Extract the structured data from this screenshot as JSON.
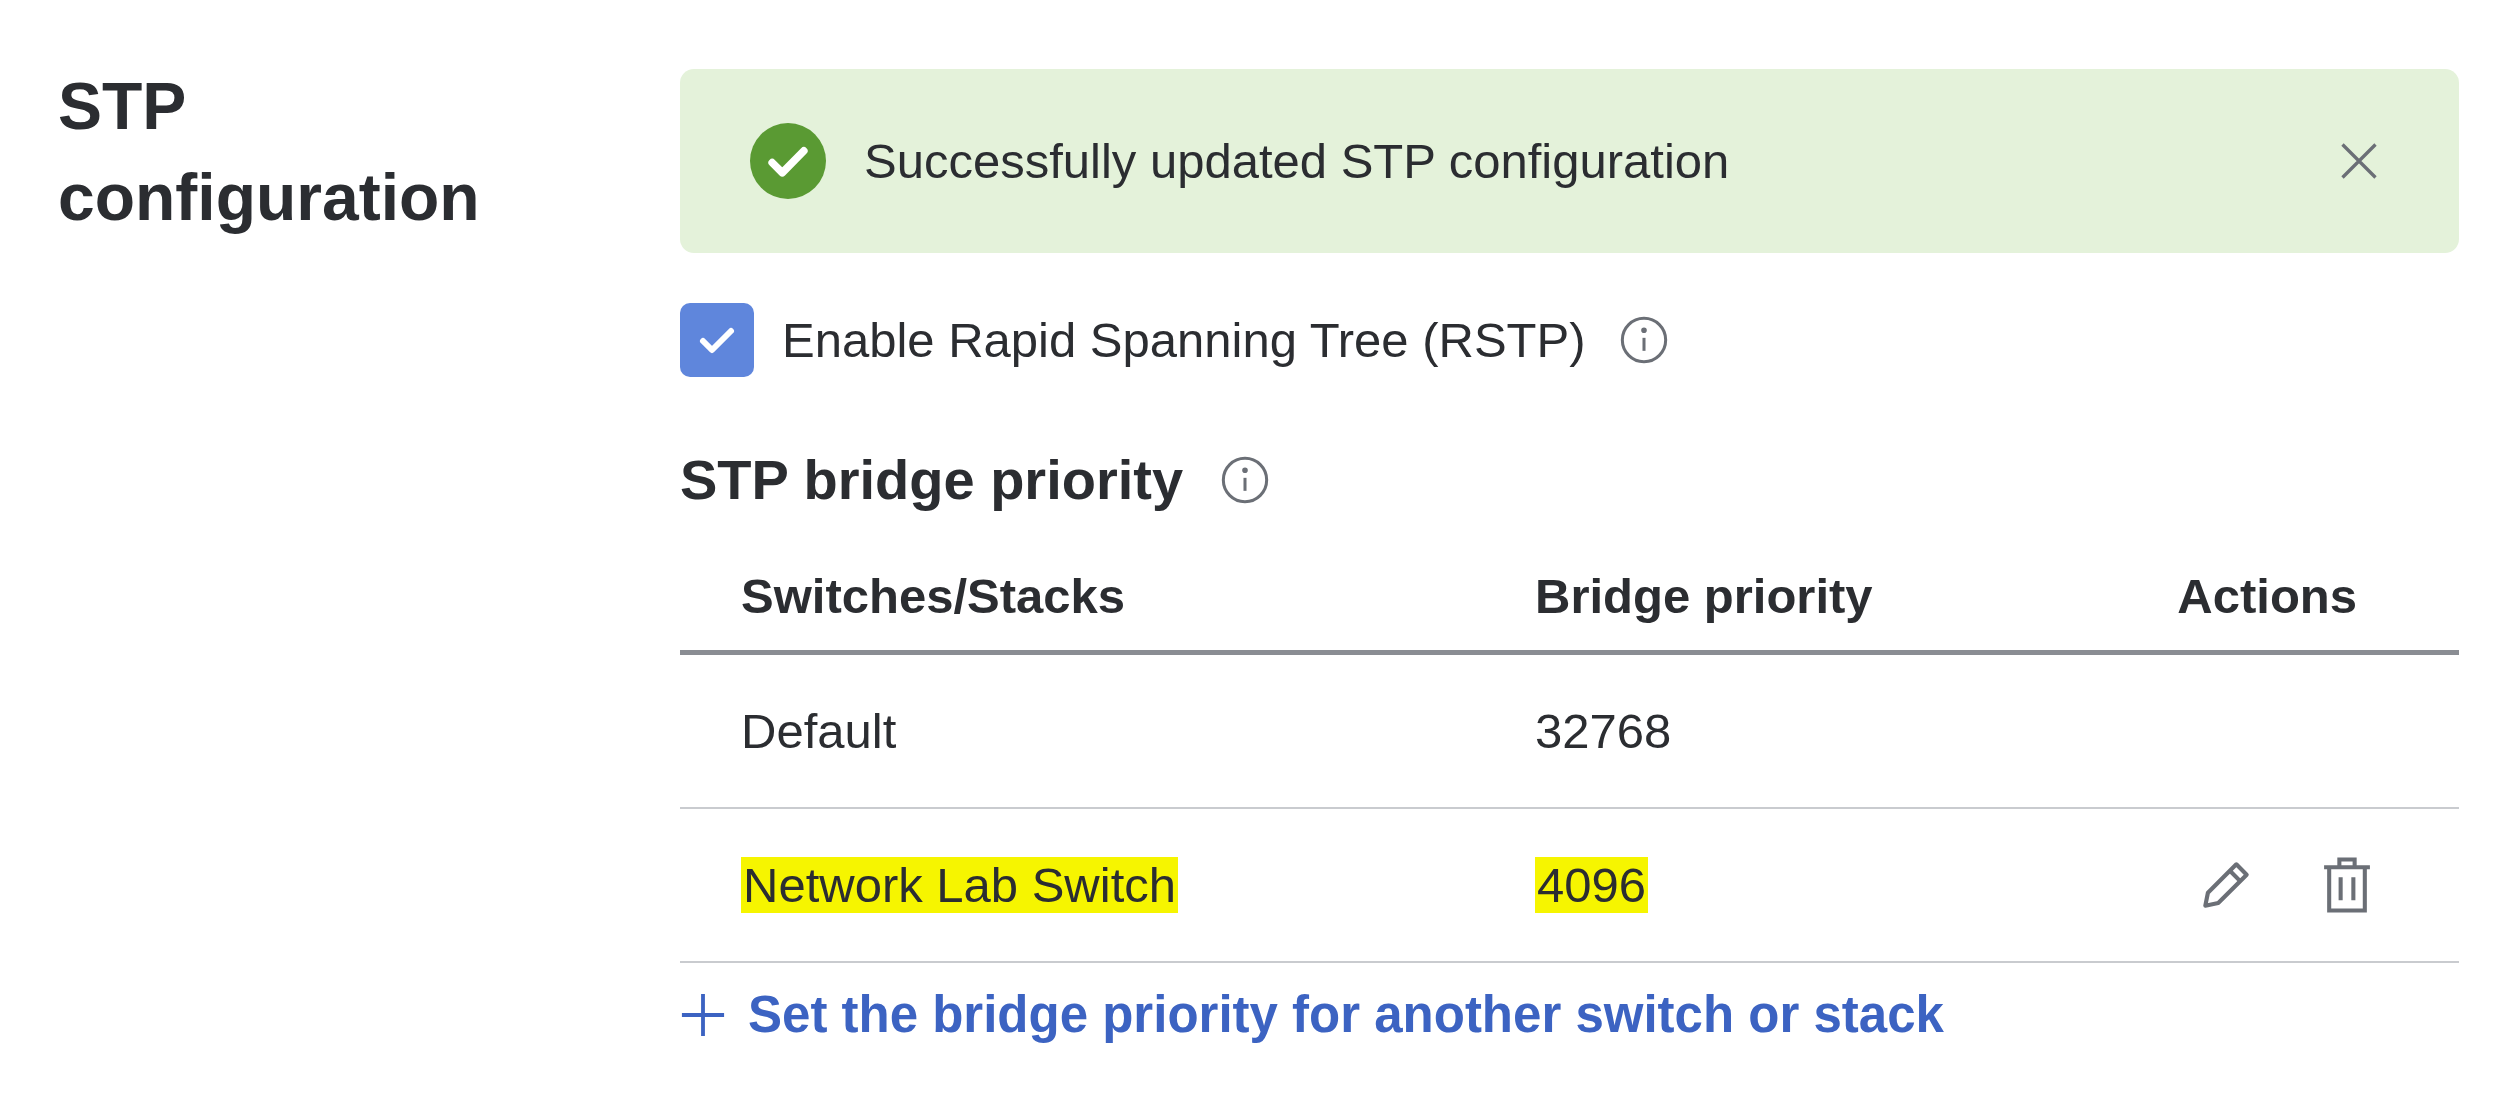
{
  "section_title": "STP configuration",
  "alert": {
    "message": "Successfully updated STP configuration"
  },
  "rstp": {
    "label": "Enable Rapid Spanning Tree (RSTP)",
    "checked": true
  },
  "bridge_priority": {
    "heading": "STP bridge priority",
    "columns": [
      "Switches/Stacks",
      "Bridge priority",
      "Actions"
    ],
    "rows": [
      {
        "switch": "Default",
        "priority": "32768",
        "highlighted": false,
        "editable": false
      },
      {
        "switch": "Network Lab Switch",
        "priority": "4096",
        "highlighted": true,
        "editable": true
      }
    ],
    "add_link": "Set the bridge priority for another switch or stack"
  }
}
